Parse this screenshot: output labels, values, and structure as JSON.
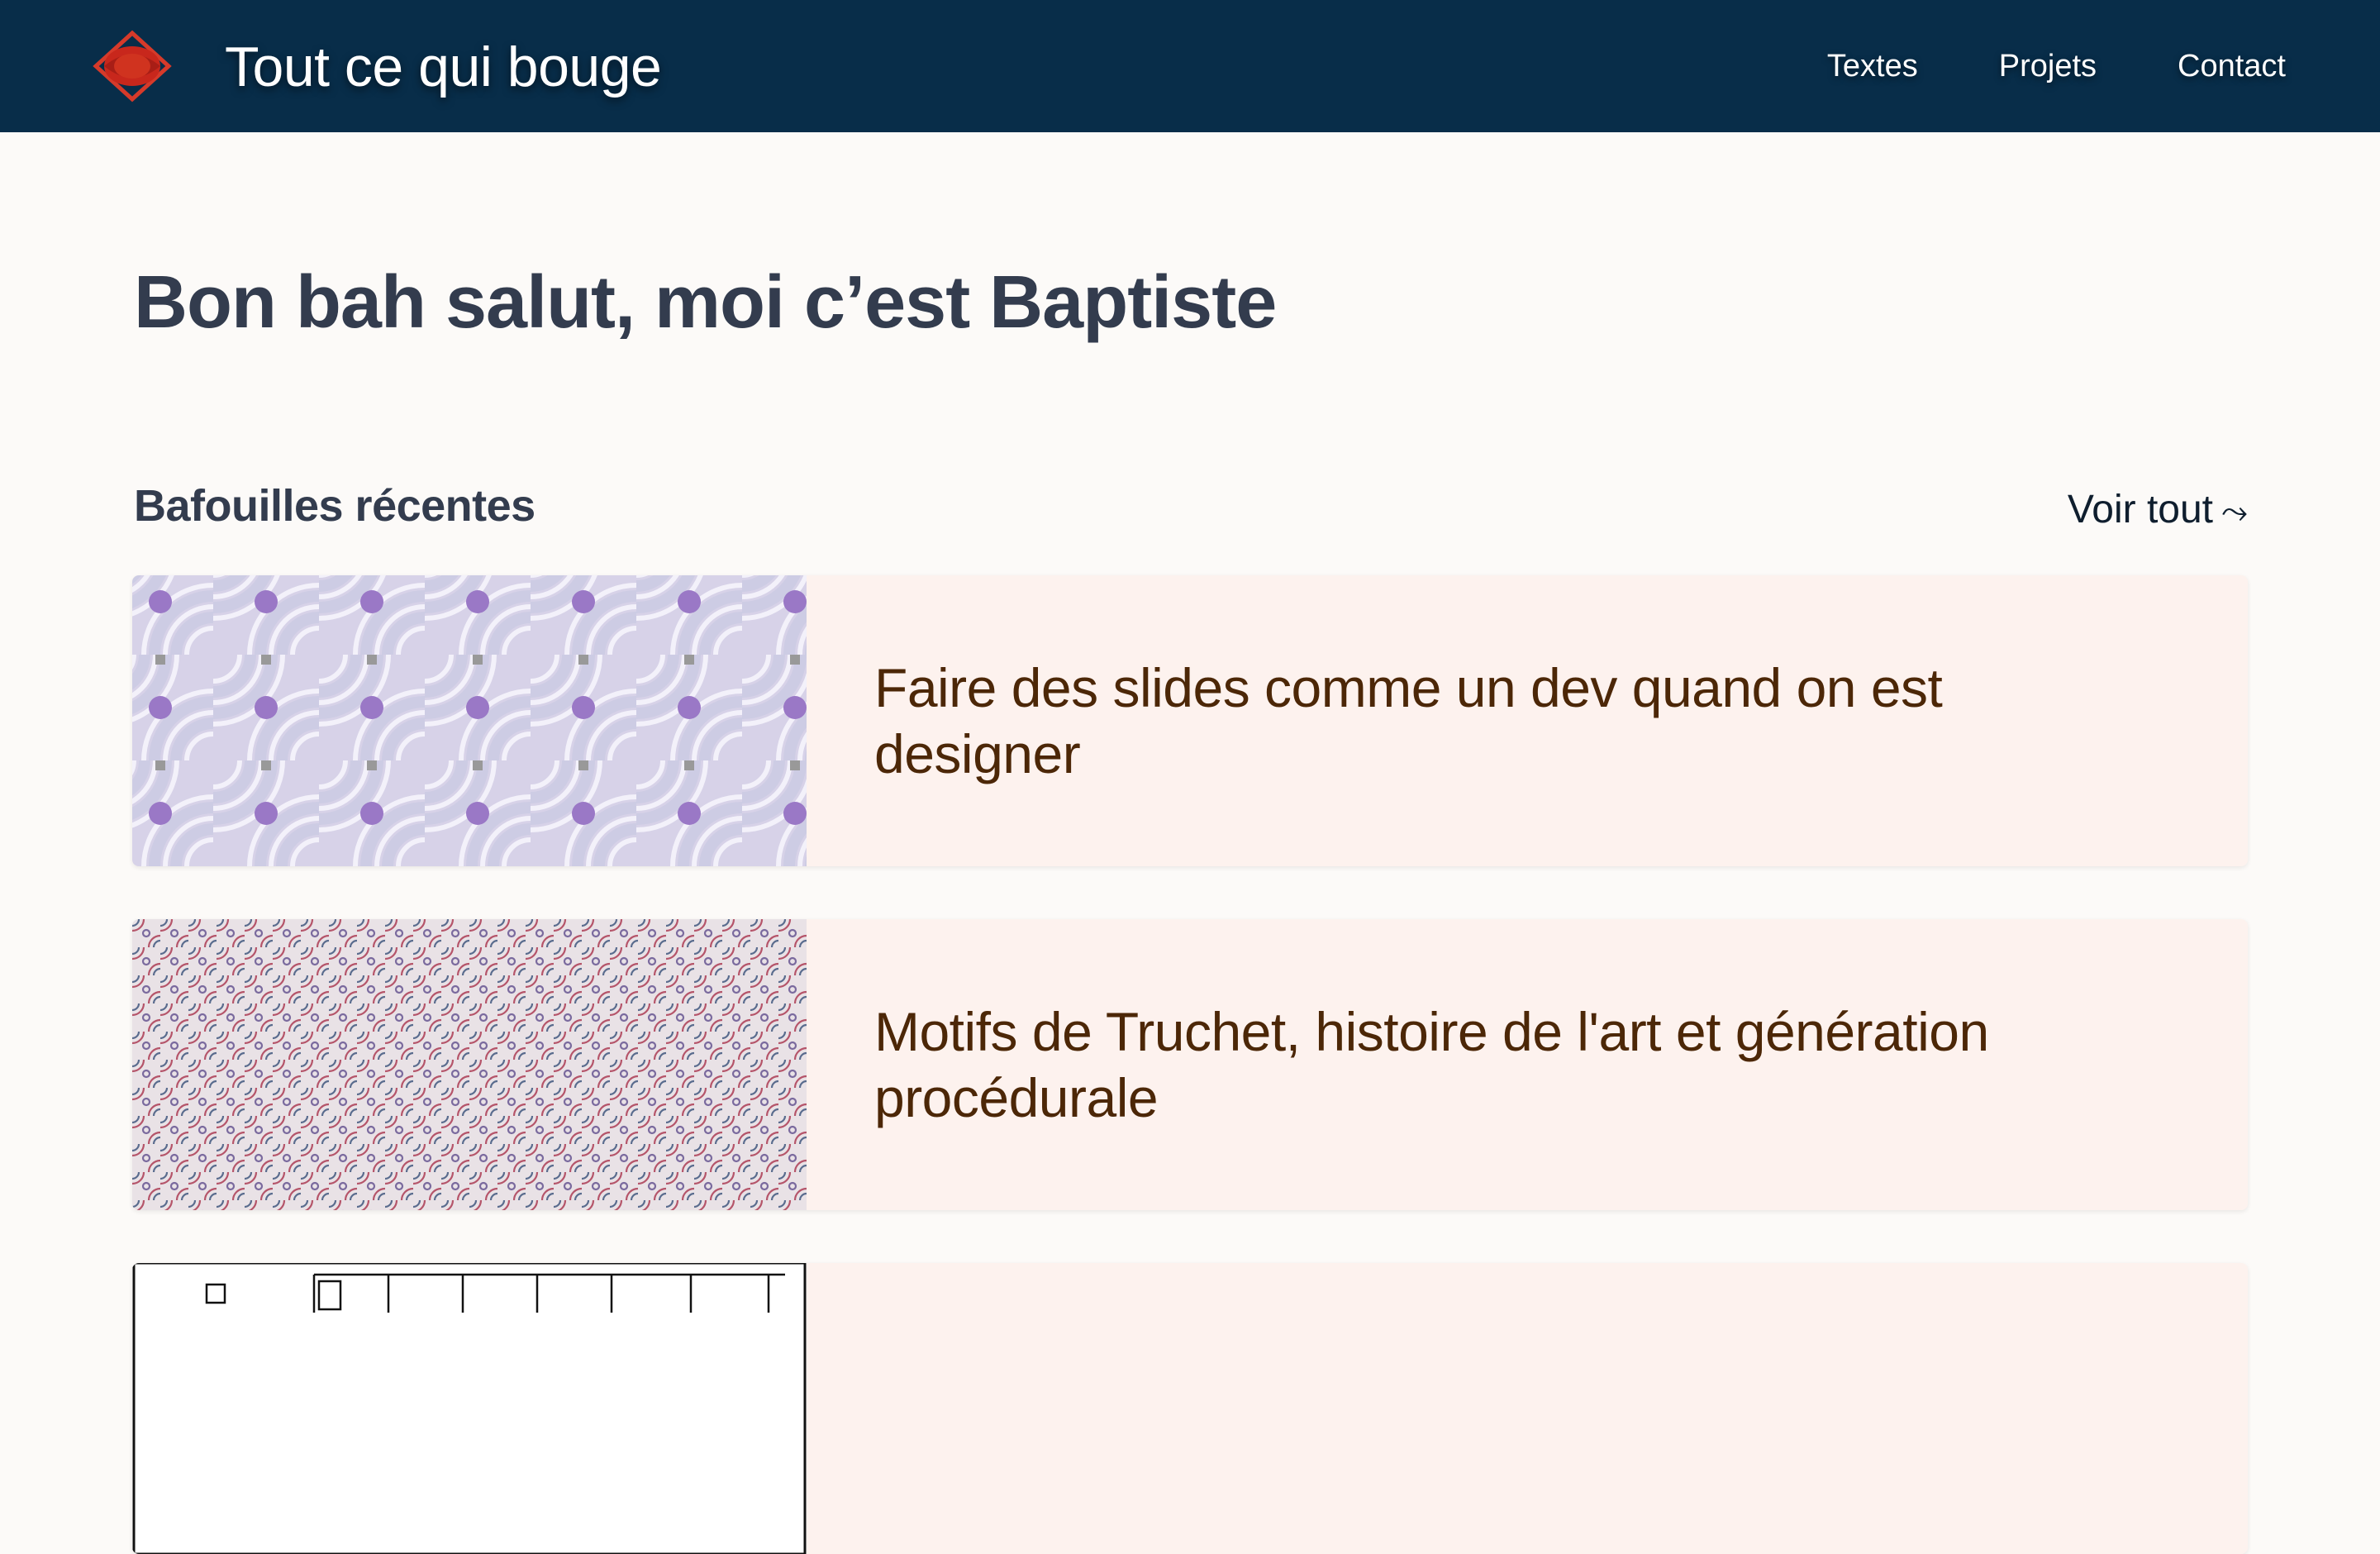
{
  "header": {
    "site_title": "Tout ce qui bouge",
    "logo_icon": "red-eye-diamond-logo",
    "nav": [
      {
        "label": "Textes"
      },
      {
        "label": "Projets"
      },
      {
        "label": "Contact"
      }
    ]
  },
  "main": {
    "greeting": "Bon bah salut, moi c’est Baptiste",
    "recent_title": "Bafouilles récentes",
    "see_all_label": "Voir tout",
    "see_all_icon": "squiggle-arrow-right-icon",
    "posts": [
      {
        "title": "Faire des slides comme un dev quand on est designer",
        "thumbnail": "truchet-pastel-arcs"
      },
      {
        "title": "Motifs de Truchet, histoire de l'art et génération procédurale",
        "thumbnail": "truchet-dense-pattern"
      },
      {
        "title": "",
        "thumbnail": "xkcd-time-table"
      }
    ]
  },
  "colors": {
    "header_bg": "#082d49",
    "page_bg": "#fcfaf8",
    "card_bg": "#fdf2ee",
    "card_title": "#4c2707",
    "heading": "#333c4e",
    "logo_red": "#d63a2a"
  }
}
